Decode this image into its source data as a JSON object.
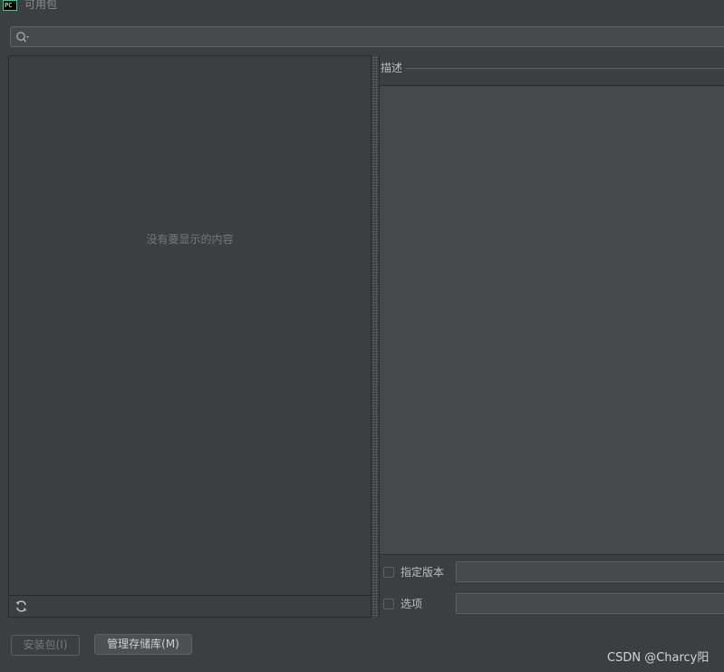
{
  "window": {
    "title": "可用包",
    "app_icon_text": "PC"
  },
  "search": {
    "placeholder": "",
    "value": ""
  },
  "package_list": {
    "empty_text": "没有要显示的内容"
  },
  "description": {
    "label": "描述"
  },
  "options": {
    "specify_version_label": "指定版本",
    "specify_version_checked": false,
    "specify_version_value": "",
    "options_label": "选项",
    "options_checked": false,
    "options_value": ""
  },
  "buttons": {
    "install_label": "安装包(I)",
    "manage_repositories_label": "管理存储库(M)"
  },
  "watermark": {
    "text": "CSDN @Charcy阳"
  },
  "icons": [
    "app-icon",
    "search-icon",
    "refresh-icon"
  ]
}
